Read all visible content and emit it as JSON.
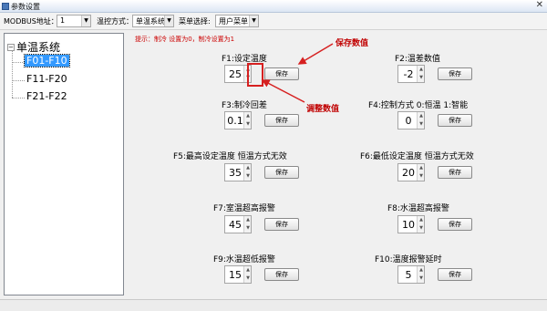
{
  "window": {
    "title": "参数设置",
    "close_glyph": "✕"
  },
  "toolbar": {
    "modbus_label": "MODBUS地址：",
    "modbus_value": "1",
    "temp_mode_label": "温控方式：",
    "temp_mode_value": "单温系统",
    "menu_label": "菜单选择:",
    "menu_value": "用户菜单"
  },
  "tree": {
    "root_label": "单温系统",
    "expand_glyph": "−",
    "items": [
      "F01-F10",
      "F11-F20",
      "F21-F22"
    ]
  },
  "hint": "提示：制冷 设置为0，制冷设置为1",
  "params": [
    {
      "label": "F1:设定温度",
      "value": "25"
    },
    {
      "label": "F2:温差数值",
      "value": "-2"
    },
    {
      "label": "F3:制冷回差",
      "value": "0.1"
    },
    {
      "label": "F4:控制方式 0:恒温 1:智能",
      "value": "0"
    },
    {
      "label": "F5:最高设定温度 恒温方式无效",
      "value": "35"
    },
    {
      "label": "F6:最低设定温度 恒温方式无效",
      "value": "20"
    },
    {
      "label": "F7:室温超高报警",
      "value": "45"
    },
    {
      "label": "F8:水温超高报警",
      "value": "10"
    },
    {
      "label": "F9:水温超低报警",
      "value": "15"
    },
    {
      "label": "F10:温度报警延时",
      "value": "5"
    }
  ],
  "save_label": "保存",
  "annotations": {
    "save_value": "保存数值",
    "adjust_value": "调整数值"
  }
}
